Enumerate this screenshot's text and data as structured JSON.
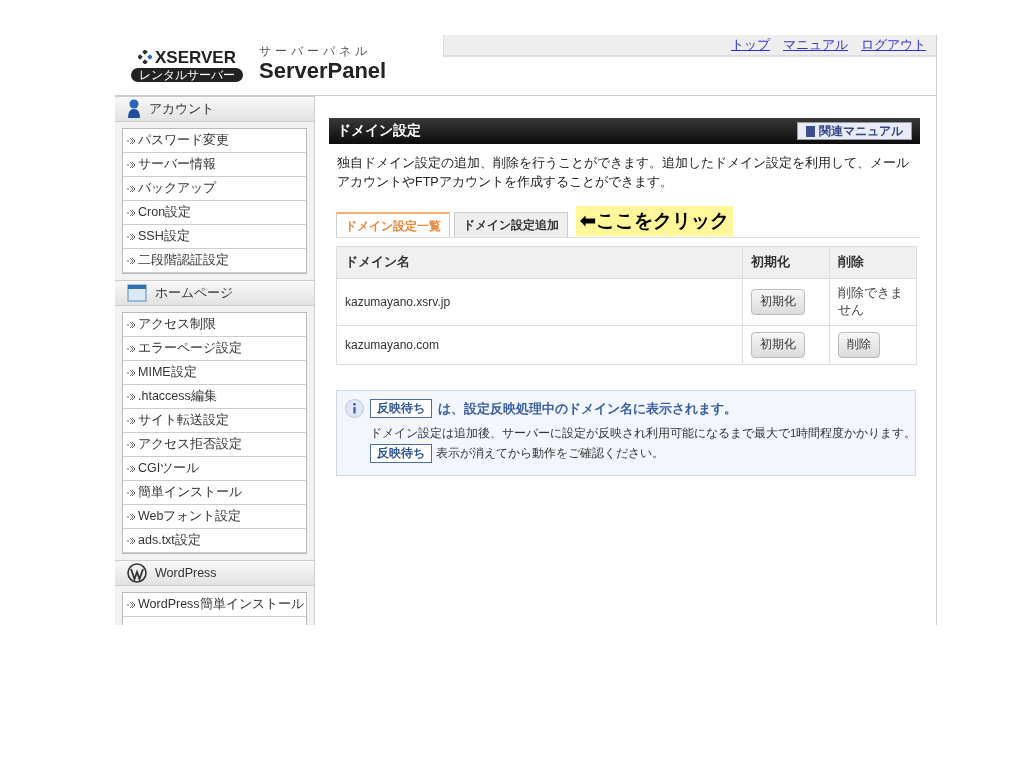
{
  "header": {
    "brand": "XSERVER",
    "brand_badge": "レンタルサーバー",
    "panel_kana": "サーバーパネル",
    "panel_name": "ServerPanel",
    "links": [
      "トップ",
      "マニュアル",
      "ログアウト"
    ]
  },
  "sidebar": {
    "sections": [
      {
        "kind": "account",
        "title": "アカウント",
        "items": [
          "パスワード変更",
          "サーバー情報",
          "バックアップ",
          "Cron設定",
          "SSH設定",
          "二段階認証設定"
        ]
      },
      {
        "kind": "homepage",
        "title": "ホームページ",
        "items": [
          "アクセス制限",
          "エラーページ設定",
          "MIME設定",
          ".htaccess編集",
          "サイト転送設定",
          "アクセス拒否設定",
          "CGIツール",
          "簡単インストール",
          "Webフォント設定",
          "ads.txt設定"
        ]
      },
      {
        "kind": "wordpress",
        "title": "WordPress",
        "items": [
          "WordPress簡単インストール"
        ]
      }
    ]
  },
  "page": {
    "title": "ドメイン設定",
    "manual_button": "関連マニュアル",
    "description": "独自ドメイン設定の追加、削除を行うことができます。追加したドメイン設定を利用して、メールアカウントやFTPアカウントを作成することができます。",
    "tabs": [
      {
        "label": "ドメイン設定一覧",
        "selected": true
      },
      {
        "label": "ドメイン設定追加",
        "selected": false
      }
    ],
    "callout": "⬅ここをクリック",
    "table": {
      "columns": [
        "ドメイン名",
        "初期化",
        "削除"
      ],
      "rows": [
        {
          "domain": "kazumayano.xsrv.jp",
          "reset": "初期化",
          "delete": {
            "kind": "text",
            "label": "削除できません"
          }
        },
        {
          "domain": "kazumayano.com",
          "reset": "初期化",
          "delete": {
            "kind": "button",
            "label": "削除"
          }
        }
      ]
    },
    "info": {
      "tag": "反映待ち",
      "headline": "は、設定反映処理中のドメイン名に表示されます。",
      "note": "ドメイン設定は追加後、サーバーに設定が反映され利用可能になるまで最大で1時間程度かかります。",
      "tag2": "反映待ち",
      "note2": "表示が消えてから動作をご確認ください。"
    }
  }
}
